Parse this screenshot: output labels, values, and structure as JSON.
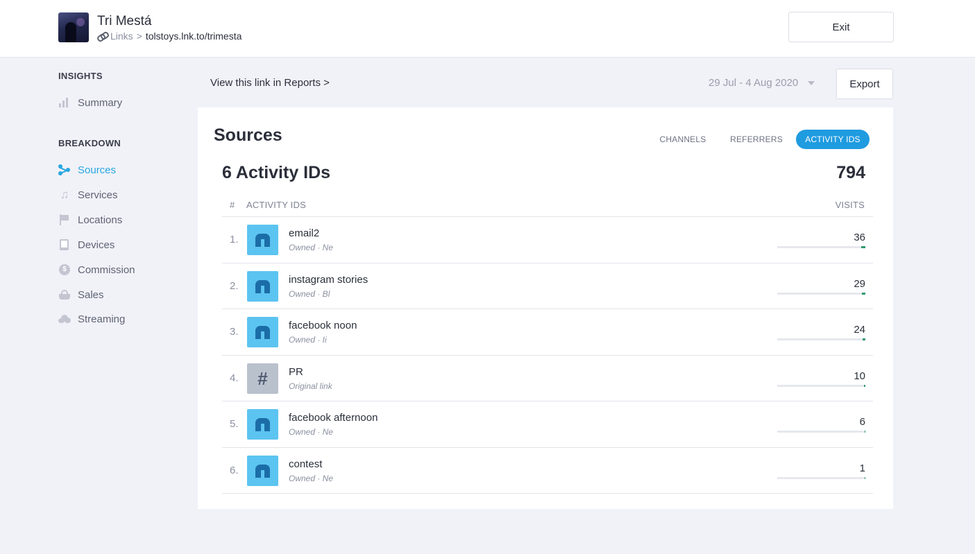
{
  "header": {
    "artist_name": "Tri Mestá",
    "crumb_links": "Links",
    "crumb_separator": ">",
    "crumb_url": "tolstoys.lnk.to/trimesta",
    "exit_label": "Exit"
  },
  "sidebar": {
    "insights_heading": "INSIGHTS",
    "summary_label": "Summary",
    "breakdown_heading": "BREAKDOWN",
    "items": [
      {
        "label": "Sources",
        "icon": "sources-icon",
        "active": true
      },
      {
        "label": "Services",
        "icon": "music-note-icon",
        "active": false
      },
      {
        "label": "Locations",
        "icon": "flag-icon",
        "active": false
      },
      {
        "label": "Devices",
        "icon": "device-icon",
        "active": false
      },
      {
        "label": "Commission",
        "icon": "coin-icon",
        "active": false
      },
      {
        "label": "Sales",
        "icon": "basket-icon",
        "active": false
      },
      {
        "label": "Streaming",
        "icon": "cloud-icon",
        "active": false
      }
    ],
    "accent_color": "#29a7e0"
  },
  "toolbar": {
    "view_link": "View this link in Reports >",
    "date_range": "29 Jul - 4 Aug 2020",
    "export_label": "Export"
  },
  "card": {
    "title": "Sources",
    "tabs": [
      {
        "label": "CHANNELS",
        "active": false
      },
      {
        "label": "REFERRERS",
        "active": false
      },
      {
        "label": "ACTIVITY IDS",
        "active": true
      }
    ],
    "count_title": "6 Activity IDs",
    "total": "794",
    "columns": {
      "index": "#",
      "name": "ACTIVITY IDS",
      "visits": "VISITS"
    },
    "rows": [
      {
        "index": "1.",
        "name": "email2",
        "sub": "Owned · Ne",
        "visits": "36",
        "share": 0.045,
        "icon": "house-icon"
      },
      {
        "index": "2.",
        "name": "instagram stories",
        "sub": "Owned · Bl",
        "visits": "29",
        "share": 0.037,
        "icon": "house-icon"
      },
      {
        "index": "3.",
        "name": "facebook noon",
        "sub": "Owned · Ii",
        "visits": "24",
        "share": 0.03,
        "icon": "house-icon"
      },
      {
        "index": "4.",
        "name": "PR",
        "sub": "Original link",
        "visits": "10",
        "share": 0.013,
        "icon": "hash-icon"
      },
      {
        "index": "5.",
        "name": "facebook afternoon",
        "sub": "Owned · Ne",
        "visits": "6",
        "share": 0.008,
        "icon": "house-icon"
      },
      {
        "index": "6.",
        "name": "contest",
        "sub": "Owned · Ne",
        "visits": "1",
        "share": 0.001,
        "icon": "house-icon"
      }
    ],
    "tab_active_color": "#1f9be0",
    "bar_color": "#2e9b6f"
  }
}
